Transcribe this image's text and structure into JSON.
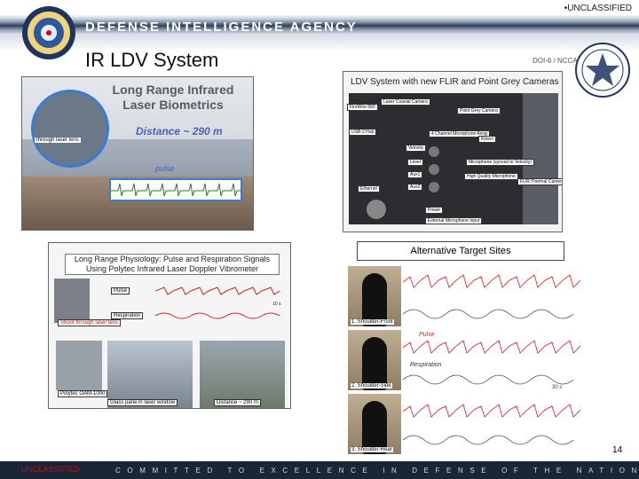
{
  "header": {
    "classification": "•UNCLASSIFIED",
    "agency_name": "DEFENSE INTELLIGENCE AGENCY"
  },
  "slide": {
    "title": "IR LDV System",
    "doc_code": "DOI-6 / NCCA",
    "page_number": "14"
  },
  "photo_a": {
    "title": "Long Range Infrared Laser Biometrics",
    "distance": "Distance ~ 290 m",
    "inset_label": "through laser lens",
    "pulse_label": "pulse"
  },
  "photo_b": {
    "title": "LDV System with new FLIR and Point Grey Cameras",
    "labels": {
      "firewire": "FireWire 800",
      "laser_coaxial": "Laser Coaxial Camera",
      "point_grey": "Point Grey Camera",
      "usb_hub": "USB-3 Hub",
      "microphone_array": "4 Channel Microphone Array",
      "kinect": "Kinect",
      "velocity": "Velocity",
      "level": "Level",
      "microphone_sync": "Microphone (synced to Velocity)",
      "aux1": "Aux1",
      "hq_mic": "High Quality Microphone",
      "aux2": "Aux2",
      "flir": "FLIR Thermal Camera",
      "ethernet": "Ethernet",
      "power": "Power",
      "ext_mic": "External Microphone Input"
    }
  },
  "alt_targets": {
    "title": "Alternative Target Sites",
    "labels": {
      "fig1": "1. Shoulder-Front",
      "fig2": "2. Shoulder-Side",
      "fig3": "3. Shoulder-Rear",
      "pulse": "Pulse",
      "respiration": "Respiration",
      "time": "30 s"
    }
  },
  "photo_c": {
    "title": "Long Range Physiology: Pulse and Respiration Signals Using Polytec Infrared Laser Doppler Vibrometer",
    "labels": {
      "pulse": "Pulse",
      "respiration": "Respiration",
      "scale": "10 s",
      "shoot_through": "Shoot through laser lens",
      "polytec": "Polytec OAM-1000",
      "glass": "Glass pane in laser window",
      "distance": "Distance ~ 290 m"
    }
  },
  "footer": {
    "classification": "UNCLASSIFIED",
    "motto": "COMMITTED TO EXCELLENCE IN DEFENSE OF THE NATION"
  },
  "colors": {
    "header_dark": "#2c3d57",
    "footer_bg": "#1a2536",
    "classification_red": "#c01010",
    "accent_blue": "#3a7bd5",
    "signal_red": "#d02020"
  }
}
